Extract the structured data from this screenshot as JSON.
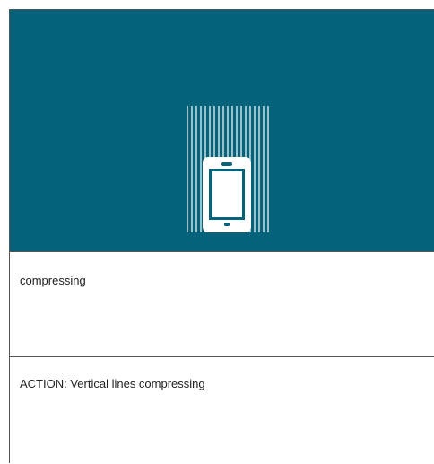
{
  "hero": {
    "background_color": "#04637a",
    "foreground_color": "#ffffff",
    "icon": "smartphone-icon",
    "animation_hint": "vertical-lines"
  },
  "description": {
    "text": "compressing"
  },
  "action": {
    "text": "ACTION: Vertical lines compressing"
  }
}
